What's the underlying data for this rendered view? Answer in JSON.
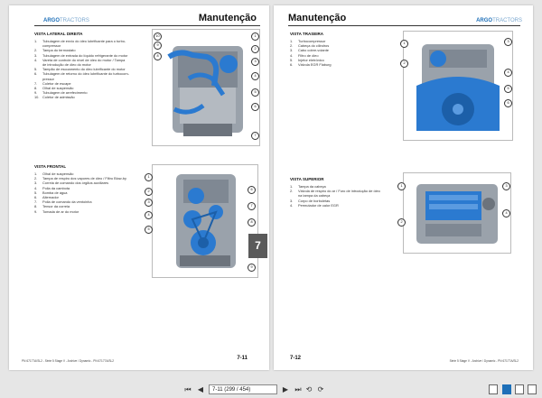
{
  "brand": {
    "a": "ARGO",
    "b": "TRACTORS"
  },
  "left_page": {
    "title": "Manutenção",
    "section1": {
      "title": "VISTA LATERAL DIREITA",
      "items": [
        {
          "n": "1.",
          "t": "Tubulagem de envio do óleo lubrificante para o turbo-"
        },
        {
          "n": "",
          "t": "compressor"
        },
        {
          "n": "2.",
          "t": "Tampa do termostato"
        },
        {
          "n": "3.",
          "t": "Tubulagem de entrada do líquido refrigerante do motor"
        },
        {
          "n": "4.",
          "t": "Vareta de controle do nível de óleo do motor / Tampa"
        },
        {
          "n": "",
          "t": "de introdução de óleo do motor"
        },
        {
          "n": "5.",
          "t": "Tampão de escoamento do óleo lubrificante do motor"
        },
        {
          "n": "6.",
          "t": "Tubulagem de retorno do óleo lubrificante do turbocom-"
        },
        {
          "n": "",
          "t": "pressor"
        },
        {
          "n": "7.",
          "t": "Coletor de escape"
        },
        {
          "n": "8.",
          "t": "Olhal de suspensão"
        },
        {
          "n": "9.",
          "t": "Tubulagem de arrefecimento"
        },
        {
          "n": "10.",
          "t": "Coletor de admissão"
        }
      ]
    },
    "section2": {
      "title": "VISTA FRONTAL",
      "items": [
        {
          "n": "1.",
          "t": "Olhal de suspensão"
        },
        {
          "n": "2.",
          "t": "Tampa de respiro dos vapores de óleo / Filtro Blow-by"
        },
        {
          "n": "3.",
          "t": "Correia de comando dos órgãos auxiliares"
        },
        {
          "n": "4.",
          "t": "Polia da cambota"
        },
        {
          "n": "5.",
          "t": "Bomba de água"
        },
        {
          "n": "6.",
          "t": "Alternador"
        },
        {
          "n": "7.",
          "t": "Polia de comando da ventoinha"
        },
        {
          "n": "8.",
          "t": "Tensor da correia"
        },
        {
          "n": "9.",
          "t": "Tomada de ar do motor"
        }
      ]
    },
    "footer_text": "PN 67177A/SL2 - Série 5 Stage V - Archive / Dynamic - PN 67177A/SL2",
    "page_number": "7-11"
  },
  "right_page": {
    "title": "Manutenção",
    "section1": {
      "title": "VISTA TRASEIRA",
      "items": [
        {
          "n": "1.",
          "t": "Turbocompressor"
        },
        {
          "n": "2.",
          "t": "Cabeça do cilindros"
        },
        {
          "n": "3.",
          "t": "Cabo cobre-volante"
        },
        {
          "n": "4.",
          "t": "Filtro de óleo"
        },
        {
          "n": "5.",
          "t": "Injetor eletrônico"
        },
        {
          "n": "6.",
          "t": "Válvula EGR Flaburg"
        }
      ]
    },
    "section2": {
      "title": "VISTA SUPERIOR",
      "items": [
        {
          "n": "1.",
          "t": "Tampa da cabeça"
        },
        {
          "n": "2.",
          "t": "Válvula de respiro do ar / Furo de introdução de óleo"
        },
        {
          "n": "",
          "t": "na tampa da cabeça"
        },
        {
          "n": "3.",
          "t": "Corpo de borboletas"
        },
        {
          "n": "4.",
          "t": "Permutador de calor EGR"
        }
      ]
    },
    "footer_text": "Série 5 Stage V - Archive / Dynamic - PN 67177A/SL2",
    "page_number": "7-12"
  },
  "chapter_tab": "7",
  "figure_callouts": {
    "side": [
      "10",
      "9",
      "8",
      "1",
      "2",
      "3",
      "4",
      "5",
      "6",
      "7"
    ],
    "front": [
      "1",
      "2",
      "3",
      "4",
      "5",
      "6",
      "7",
      "8",
      "9"
    ],
    "rear": [
      "1",
      "2",
      "3",
      "4",
      "5",
      "6"
    ],
    "top": [
      "1",
      "2",
      "3",
      "4"
    ]
  },
  "toolbar": {
    "page_field": "7-11 (299 / 454)"
  },
  "colors": {
    "accent": "#1d6fb8",
    "engine_blue": "#2b7ad0",
    "tab": "#5a5a5a"
  }
}
